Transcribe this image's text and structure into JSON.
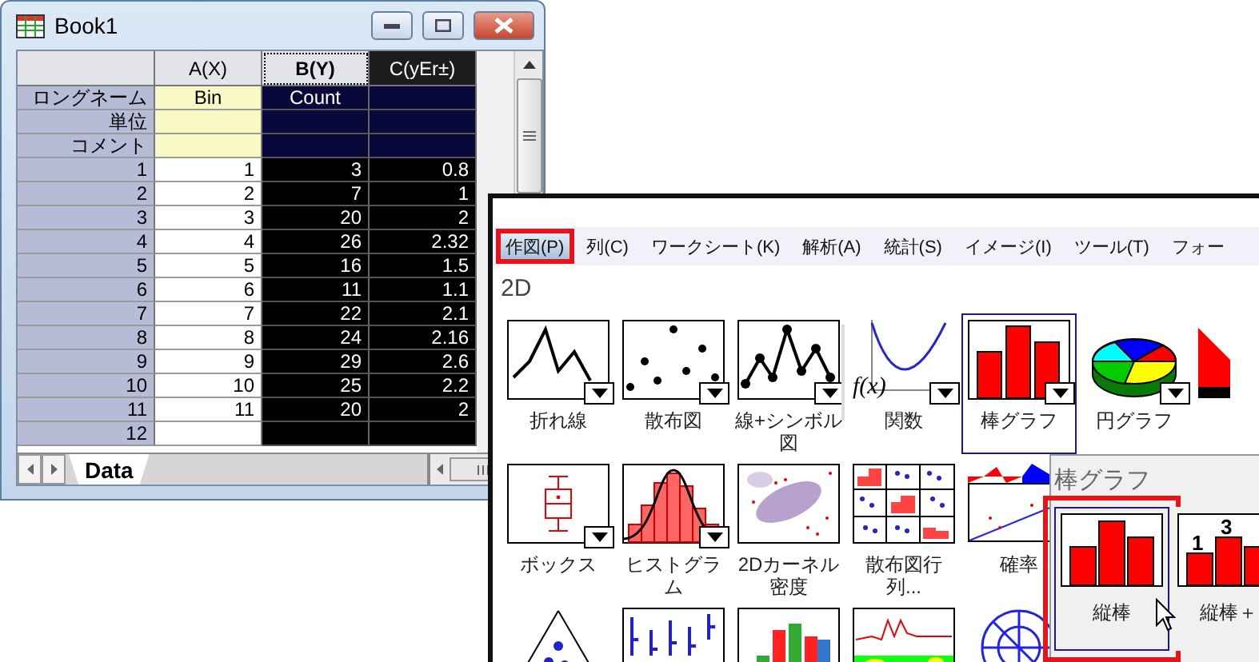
{
  "book": {
    "title": "Book1",
    "columns": [
      {
        "label": "A(X)",
        "selected": false,
        "focused": false
      },
      {
        "label": "B(Y)",
        "selected": true,
        "focused": true
      },
      {
        "label": "C(yEr±)",
        "selected": true,
        "focused": false
      }
    ],
    "header_rows": [
      {
        "label": "ロングネーム",
        "a": "Bin",
        "b": "Count"
      },
      {
        "label": "単位"
      },
      {
        "label": "コメント"
      }
    ],
    "rows": [
      {
        "index": "1",
        "a": "1",
        "b": "3",
        "c": "0.8"
      },
      {
        "index": "2",
        "a": "2",
        "b": "7",
        "c": "1"
      },
      {
        "index": "3",
        "a": "3",
        "b": "20",
        "c": "2"
      },
      {
        "index": "4",
        "a": "4",
        "b": "26",
        "c": "2.32"
      },
      {
        "index": "5",
        "a": "5",
        "b": "16",
        "c": "1.5"
      },
      {
        "index": "6",
        "a": "6",
        "b": "11",
        "c": "1.1"
      },
      {
        "index": "7",
        "a": "7",
        "b": "22",
        "c": "2.1"
      },
      {
        "index": "8",
        "a": "8",
        "b": "24",
        "c": "2.16"
      },
      {
        "index": "9",
        "a": "9",
        "b": "29",
        "c": "2.6"
      },
      {
        "index": "10",
        "a": "10",
        "b": "25",
        "c": "2.2"
      },
      {
        "index": "11",
        "a": "11",
        "b": "20",
        "c": "2"
      },
      {
        "index": "12"
      }
    ],
    "sheet_tabs": [
      {
        "label": "Data",
        "selected": true
      }
    ]
  },
  "menu": [
    {
      "label": "作図(P)",
      "selected": true
    },
    {
      "label": "列(C)",
      "selected": false
    },
    {
      "label": "ワークシート(K)",
      "selected": false
    },
    {
      "label": "解析(A)",
      "selected": false
    },
    {
      "label": "統計(S)",
      "selected": false
    },
    {
      "label": "イメージ(I)",
      "selected": false
    },
    {
      "label": "ツール(T)",
      "selected": false
    },
    {
      "label": "フォー",
      "selected": false
    }
  ],
  "gallery": {
    "section": "2D",
    "rows": [
      [
        {
          "kind": "line",
          "label": "折れ線",
          "has_menu": true,
          "selected": false
        },
        {
          "kind": "scatter",
          "label": "散布図",
          "has_menu": true,
          "selected": false
        },
        {
          "kind": "line_symbol",
          "label": "線+シンボル図",
          "has_menu": true,
          "selected": false
        },
        {
          "kind": "function",
          "formula": "f(x)",
          "label": "関数",
          "has_menu": true,
          "selected": false
        },
        {
          "kind": "bar",
          "label": "棒グラフ",
          "has_menu": true,
          "selected": true
        },
        {
          "kind": "pie",
          "label": "円グラフ",
          "has_menu": true,
          "selected": false
        },
        {
          "kind": "area",
          "has_menu": false,
          "selected": false
        }
      ],
      [
        {
          "kind": "box",
          "label": "ボックス",
          "has_menu": true,
          "selected": false
        },
        {
          "kind": "histogram",
          "label": "ヒストグラム",
          "has_menu": true,
          "selected": false
        },
        {
          "kind": "kernel",
          "label": "2Dカーネル密度",
          "has_menu": false,
          "selected": false
        },
        {
          "kind": "matrix",
          "label": "散布図行列...",
          "has_menu": false,
          "selected": false
        },
        {
          "kind": "probability",
          "label": "確率",
          "has_menu": false,
          "selected": false
        }
      ],
      [
        {
          "kind": "ternary",
          "has_menu": false,
          "selected": false
        },
        {
          "kind": "droplines",
          "has_menu": false,
          "selected": false
        },
        {
          "kind": "stacked",
          "has_menu": false,
          "selected": false
        },
        {
          "kind": "contour",
          "has_menu": false,
          "selected": false
        },
        {
          "kind": "polar",
          "has_menu": false,
          "selected": false
        }
      ]
    ]
  },
  "submenu": {
    "title": "棒グラフ",
    "items": [
      {
        "kind": "column",
        "label": "縦棒",
        "selected": true
      },
      {
        "kind": "column_labels",
        "label": "縦棒＋",
        "selected": false,
        "value_labels": [
          "1",
          "3"
        ]
      }
    ]
  }
}
